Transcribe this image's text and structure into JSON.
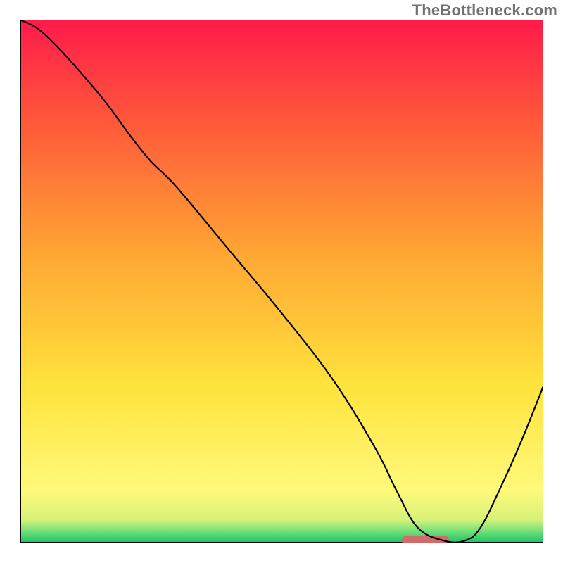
{
  "watermark": "TheBottleneck.com",
  "chart_data": {
    "type": "line",
    "title": "",
    "xlabel": "",
    "ylabel": "",
    "xlim": [
      0,
      100
    ],
    "ylim": [
      0,
      100
    ],
    "grid": false,
    "legend": false,
    "background_gradient": {
      "stops": [
        {
          "offset": 0.0,
          "color": "#ff1a4b"
        },
        {
          "offset": 0.2,
          "color": "#ff5a3a"
        },
        {
          "offset": 0.45,
          "color": "#ffa734"
        },
        {
          "offset": 0.7,
          "color": "#ffe33d"
        },
        {
          "offset": 0.9,
          "color": "#fff97a"
        },
        {
          "offset": 0.955,
          "color": "#d7f27a"
        },
        {
          "offset": 0.975,
          "color": "#7be27a"
        },
        {
          "offset": 1.0,
          "color": "#18c268"
        }
      ]
    },
    "marker": {
      "x_center": 77.5,
      "y": 0.5,
      "width": 9,
      "height": 2.0,
      "color": "#d36a6a"
    },
    "series": [
      {
        "name": "curve",
        "color": "#000000",
        "stroke_width": 2.2,
        "x": [
          0,
          5,
          15,
          21,
          25,
          30,
          40,
          50,
          60,
          68,
          72,
          76,
          81,
          85,
          88,
          92,
          96,
          100
        ],
        "y": [
          100,
          97,
          86,
          78,
          73,
          68,
          56,
          44,
          31,
          18,
          10,
          3,
          0.5,
          0.5,
          3,
          11,
          20,
          30
        ]
      }
    ]
  }
}
